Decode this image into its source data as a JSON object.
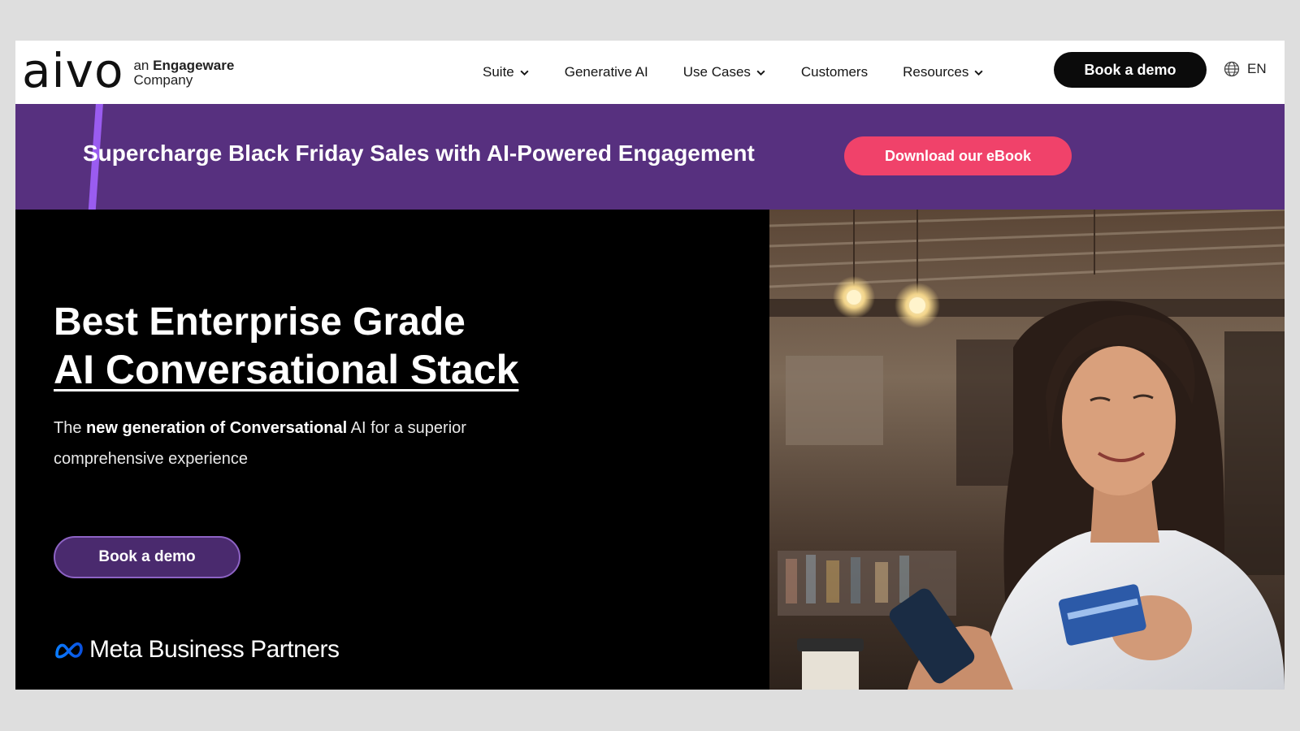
{
  "header": {
    "logo": {
      "word": "aivo",
      "tag_prefix": "an",
      "tag_brand": "Engageware",
      "tag_suffix": "Company"
    },
    "nav": [
      {
        "label": "Suite",
        "dropdown": true
      },
      {
        "label": "Generative AI",
        "dropdown": false
      },
      {
        "label": "Use Cases",
        "dropdown": true
      },
      {
        "label": "Customers",
        "dropdown": false
      },
      {
        "label": "Resources",
        "dropdown": true
      }
    ],
    "cta_label": "Book a demo",
    "language": "EN"
  },
  "banner": {
    "text": "Supercharge Black Friday Sales with AI-Powered Engagement",
    "button_label": "Download our eBook",
    "colors": {
      "background": "#57307f",
      "button": "#f0426a",
      "stripe": "#9a5cf0"
    }
  },
  "hero": {
    "title_line1": "Best Enterprise Grade",
    "title_line2": "AI Conversational Stack",
    "subtitle_pre": "The",
    "subtitle_bold": "new generation of Conversational",
    "subtitle_post": "AI for a superior comprehensive experience",
    "button_label": "Book a demo",
    "partner_label": "Meta Business Partners",
    "image_icon": "woman-with-phone-and-credit-card-photo"
  }
}
